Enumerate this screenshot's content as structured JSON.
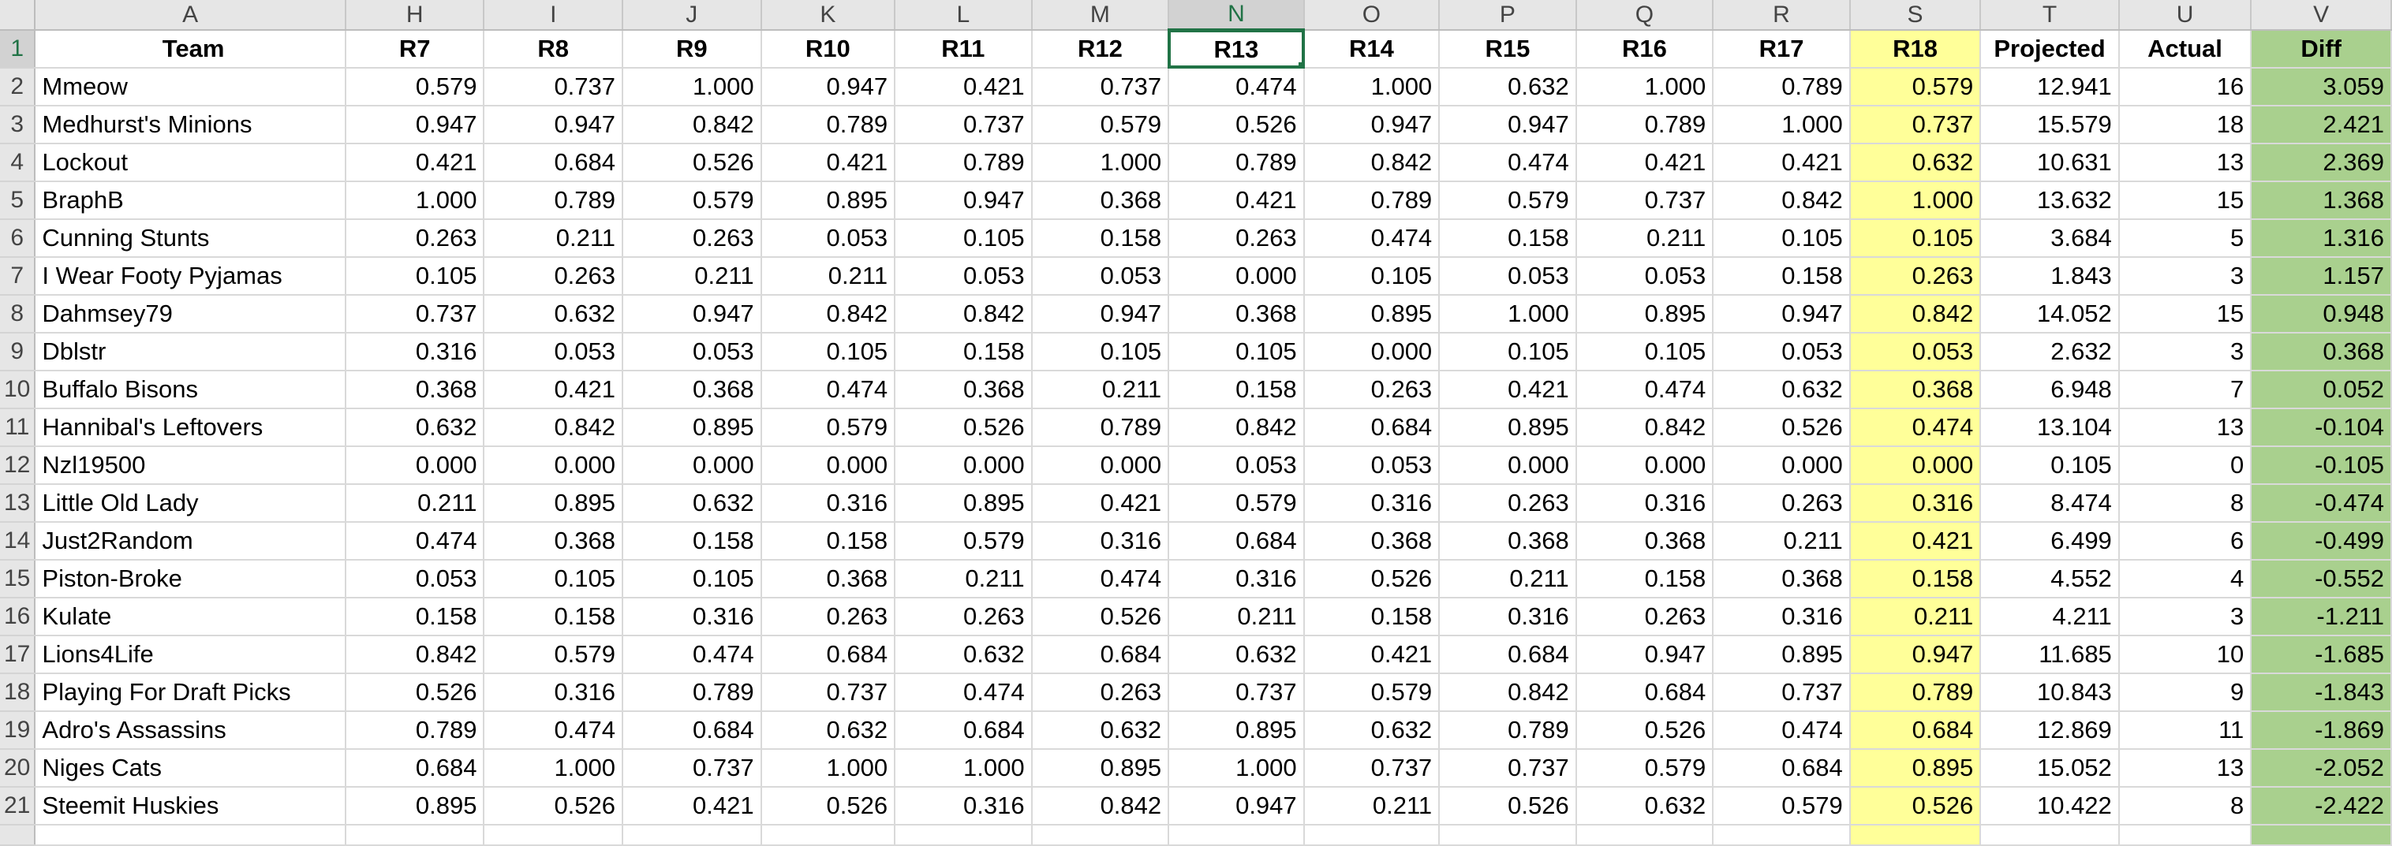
{
  "sheet": {
    "columns": [
      "A",
      "H",
      "I",
      "J",
      "K",
      "L",
      "M",
      "N",
      "O",
      "P",
      "Q",
      "R",
      "S",
      "T",
      "U",
      "V"
    ],
    "selected_column": "N",
    "selected_row": "1",
    "header_row": {
      "row_num": "1",
      "cells": [
        "Team",
        "R7",
        "R8",
        "R9",
        "R10",
        "R11",
        "R12",
        "R13",
        "R14",
        "R15",
        "R16",
        "R17",
        "R18",
        "Projected",
        "Actual",
        "Diff"
      ]
    },
    "rows": [
      {
        "row_num": "2",
        "cells": [
          "Mmeow",
          "0.579",
          "0.737",
          "1.000",
          "0.947",
          "0.421",
          "0.737",
          "0.474",
          "1.000",
          "0.632",
          "1.000",
          "0.789",
          "0.579",
          "12.941",
          "16",
          "3.059"
        ]
      },
      {
        "row_num": "3",
        "cells": [
          "Medhurst's Minions",
          "0.947",
          "0.947",
          "0.842",
          "0.789",
          "0.737",
          "0.579",
          "0.526",
          "0.947",
          "0.947",
          "0.789",
          "1.000",
          "0.737",
          "15.579",
          "18",
          "2.421"
        ]
      },
      {
        "row_num": "4",
        "cells": [
          "Lockout",
          "0.421",
          "0.684",
          "0.526",
          "0.421",
          "0.789",
          "1.000",
          "0.789",
          "0.842",
          "0.474",
          "0.421",
          "0.421",
          "0.632",
          "10.631",
          "13",
          "2.369"
        ]
      },
      {
        "row_num": "5",
        "cells": [
          "BraphB",
          "1.000",
          "0.789",
          "0.579",
          "0.895",
          "0.947",
          "0.368",
          "0.421",
          "0.789",
          "0.579",
          "0.737",
          "0.842",
          "1.000",
          "13.632",
          "15",
          "1.368"
        ]
      },
      {
        "row_num": "6",
        "cells": [
          "Cunning Stunts",
          "0.263",
          "0.211",
          "0.263",
          "0.053",
          "0.105",
          "0.158",
          "0.263",
          "0.474",
          "0.158",
          "0.211",
          "0.105",
          "0.105",
          "3.684",
          "5",
          "1.316"
        ]
      },
      {
        "row_num": "7",
        "cells": [
          "I Wear Footy Pyjamas",
          "0.105",
          "0.263",
          "0.211",
          "0.211",
          "0.053",
          "0.053",
          "0.000",
          "0.105",
          "0.053",
          "0.053",
          "0.158",
          "0.263",
          "1.843",
          "3",
          "1.157"
        ]
      },
      {
        "row_num": "8",
        "cells": [
          "Dahmsey79",
          "0.737",
          "0.632",
          "0.947",
          "0.842",
          "0.842",
          "0.947",
          "0.368",
          "0.895",
          "1.000",
          "0.895",
          "0.947",
          "0.842",
          "14.052",
          "15",
          "0.948"
        ]
      },
      {
        "row_num": "9",
        "cells": [
          "Dblstr",
          "0.316",
          "0.053",
          "0.053",
          "0.105",
          "0.158",
          "0.105",
          "0.105",
          "0.000",
          "0.105",
          "0.105",
          "0.053",
          "0.053",
          "2.632",
          "3",
          "0.368"
        ]
      },
      {
        "row_num": "10",
        "cells": [
          "Buffalo Bisons",
          "0.368",
          "0.421",
          "0.368",
          "0.474",
          "0.368",
          "0.211",
          "0.158",
          "0.263",
          "0.421",
          "0.474",
          "0.632",
          "0.368",
          "6.948",
          "7",
          "0.052"
        ]
      },
      {
        "row_num": "11",
        "cells": [
          "Hannibal's Leftovers",
          "0.632",
          "0.842",
          "0.895",
          "0.579",
          "0.526",
          "0.789",
          "0.842",
          "0.684",
          "0.895",
          "0.842",
          "0.526",
          "0.474",
          "13.104",
          "13",
          "-0.104"
        ]
      },
      {
        "row_num": "12",
        "cells": [
          "Nzl19500",
          "0.000",
          "0.000",
          "0.000",
          "0.000",
          "0.000",
          "0.000",
          "0.053",
          "0.053",
          "0.000",
          "0.000",
          "0.000",
          "0.000",
          "0.105",
          "0",
          "-0.105"
        ]
      },
      {
        "row_num": "13",
        "cells": [
          "Little Old Lady",
          "0.211",
          "0.895",
          "0.632",
          "0.316",
          "0.895",
          "0.421",
          "0.579",
          "0.316",
          "0.263",
          "0.316",
          "0.263",
          "0.316",
          "8.474",
          "8",
          "-0.474"
        ]
      },
      {
        "row_num": "14",
        "cells": [
          "Just2Random",
          "0.474",
          "0.368",
          "0.158",
          "0.158",
          "0.579",
          "0.316",
          "0.684",
          "0.368",
          "0.368",
          "0.368",
          "0.211",
          "0.421",
          "6.499",
          "6",
          "-0.499"
        ]
      },
      {
        "row_num": "15",
        "cells": [
          "Piston-Broke",
          "0.053",
          "0.105",
          "0.105",
          "0.368",
          "0.211",
          "0.474",
          "0.316",
          "0.526",
          "0.211",
          "0.158",
          "0.368",
          "0.158",
          "4.552",
          "4",
          "-0.552"
        ]
      },
      {
        "row_num": "16",
        "cells": [
          "Kulate",
          "0.158",
          "0.158",
          "0.316",
          "0.263",
          "0.263",
          "0.526",
          "0.211",
          "0.158",
          "0.316",
          "0.263",
          "0.316",
          "0.211",
          "4.211",
          "3",
          "-1.211"
        ]
      },
      {
        "row_num": "17",
        "cells": [
          "Lions4Life",
          "0.842",
          "0.579",
          "0.474",
          "0.684",
          "0.632",
          "0.684",
          "0.632",
          "0.421",
          "0.684",
          "0.947",
          "0.895",
          "0.947",
          "11.685",
          "10",
          "-1.685"
        ]
      },
      {
        "row_num": "18",
        "cells": [
          "Playing For Draft Picks",
          "0.526",
          "0.316",
          "0.789",
          "0.737",
          "0.474",
          "0.263",
          "0.737",
          "0.579",
          "0.842",
          "0.684",
          "0.737",
          "0.789",
          "10.843",
          "9",
          "-1.843"
        ]
      },
      {
        "row_num": "19",
        "cells": [
          "Adro's Assassins",
          "0.789",
          "0.474",
          "0.684",
          "0.632",
          "0.684",
          "0.632",
          "0.895",
          "0.632",
          "0.789",
          "0.526",
          "0.474",
          "0.684",
          "12.869",
          "11",
          "-1.869"
        ]
      },
      {
        "row_num": "20",
        "cells": [
          "Niges Cats",
          "0.684",
          "1.000",
          "0.737",
          "1.000",
          "1.000",
          "0.895",
          "1.000",
          "0.737",
          "0.737",
          "0.579",
          "0.684",
          "0.895",
          "15.052",
          "13",
          "-2.052"
        ]
      },
      {
        "row_num": "21",
        "cells": [
          "Steemit Huskies",
          "0.895",
          "0.526",
          "0.421",
          "0.526",
          "0.316",
          "0.842",
          "0.947",
          "0.211",
          "0.526",
          "0.632",
          "0.579",
          "0.526",
          "10.422",
          "8",
          "-2.422"
        ]
      }
    ],
    "colors": {
      "highlight_r18": "#ffff99",
      "highlight_diff": "#a9d08e",
      "selection_accent": "#217346"
    }
  }
}
